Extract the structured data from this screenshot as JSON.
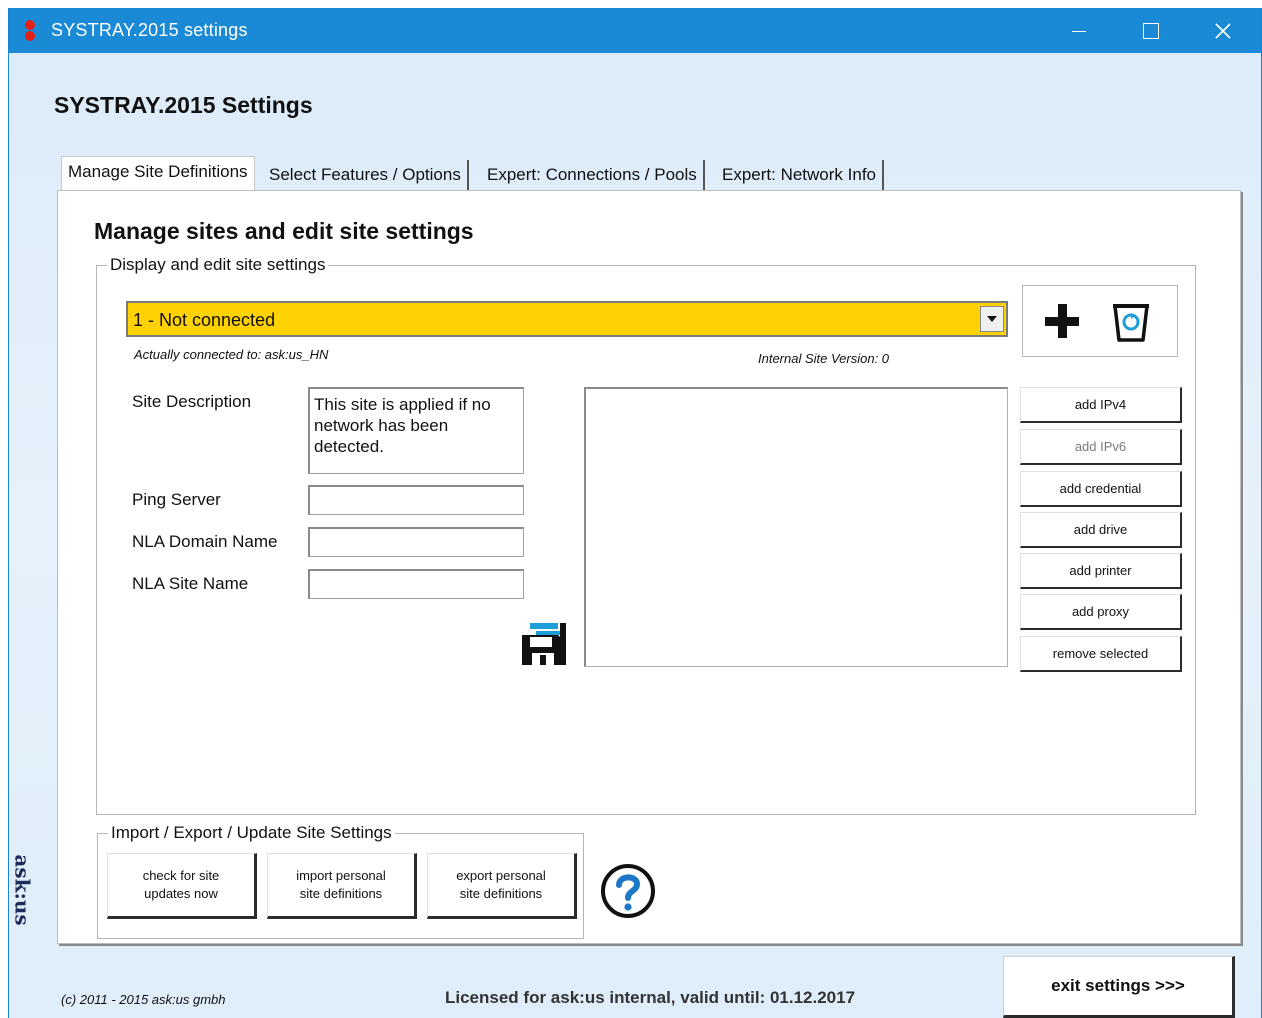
{
  "window": {
    "title": "SYSTRAY.2015 settings",
    "minimize_label": "minimize",
    "maximize_label": "maximize",
    "close_label": "close"
  },
  "app": {
    "heading": "SYSTRAY.2015 Settings"
  },
  "tabs": [
    {
      "label": "Manage Site Definitions",
      "active": true
    },
    {
      "label": "Select Features / Options",
      "active": false
    },
    {
      "label": "Expert: Connections / Pools",
      "active": false
    },
    {
      "label": "Expert: Network Info",
      "active": false
    }
  ],
  "manage": {
    "heading": "Manage sites and edit site settings",
    "display_group_legend": "Display and edit site settings",
    "selected_site": "1 - Not connected",
    "connected_to": "Actually connected to: ask:us_HN",
    "internal_version": "Internal Site Version:    0",
    "fields": {
      "site_description_label": "Site Description",
      "site_description_value": "This site is applied if no network has been detected.",
      "ping_server_label": "Ping Server",
      "ping_server_value": "",
      "nla_domain_label": "NLA Domain Name",
      "nla_domain_value": "",
      "nla_site_label": "NLA Site Name",
      "nla_site_value": ""
    },
    "side_buttons": [
      {
        "label": "add IPv4",
        "enabled": true
      },
      {
        "label": "add IPv6",
        "enabled": false
      },
      {
        "label": "add credential",
        "enabled": true
      },
      {
        "label": "add drive",
        "enabled": true
      },
      {
        "label": "add printer",
        "enabled": true
      },
      {
        "label": "add proxy",
        "enabled": true
      },
      {
        "label": "remove selected",
        "enabled": true
      }
    ]
  },
  "import_group": {
    "legend": "Import / Export / Update Site Settings",
    "buttons": [
      {
        "line1": "check for site",
        "line2": "updates now"
      },
      {
        "line1": "import personal",
        "line2": "site definitions"
      },
      {
        "line1": "export personal",
        "line2": "site definitions"
      }
    ]
  },
  "footer": {
    "copyright": "(c) 2011 - 2015 ask:us gmbh",
    "license": "Licensed for ask:us internal, valid until: 01.12.2017",
    "exit_label": "exit settings >>>",
    "logo_text": "ask:us"
  },
  "colors": {
    "titlebar": "#1b8ad6",
    "selected_site_bg": "#ffd200",
    "window_bg": "#dcebf9"
  },
  "icons": [
    "app-icon",
    "minimize-icon",
    "maximize-icon",
    "close-icon",
    "add-icon",
    "recycle-bin-icon",
    "save-icon",
    "help-icon",
    "dropdown-arrow-icon"
  ]
}
